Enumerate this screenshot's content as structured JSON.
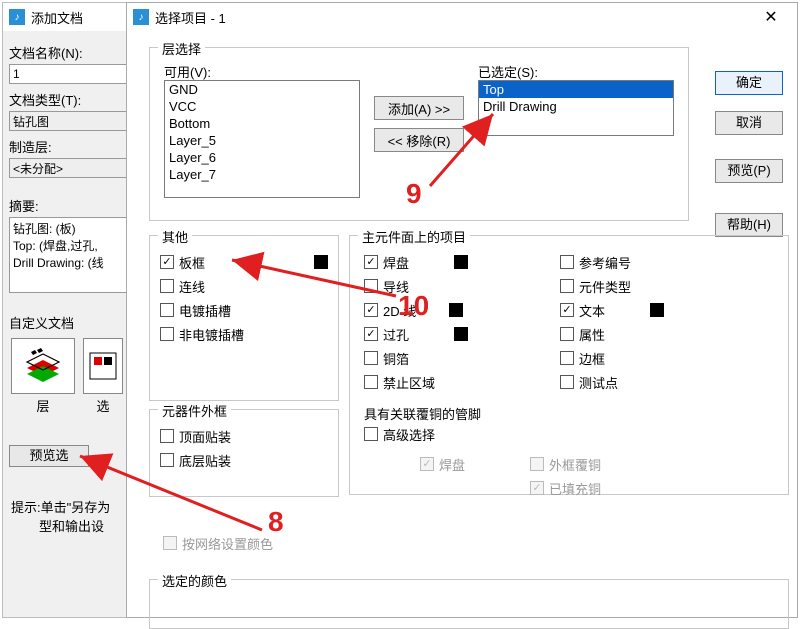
{
  "back": {
    "title": "添加文档",
    "docNameLabel": "文档名称(N):",
    "docNameValue": "1",
    "docTypeLabel": "文档类型(T):",
    "docTypeValue": "钻孔图",
    "mfgLayerLabel": "制造层:",
    "mfgLayerValue": "<未分配>",
    "summaryLabel": "摘要:",
    "summaryLines": [
      "钻孔图: (板)",
      "Top: (焊盘,过孔,",
      "Drill Drawing: (线"
    ],
    "customDocLabel": "自定义文档",
    "layerCaption": "层",
    "selCaption": "选",
    "previewBtn": "预览选",
    "hint1": "提示:单击\"另存为",
    "hint2": "型和输出设"
  },
  "front": {
    "title": "选择项目 - 1",
    "layerGroup": "层选择",
    "availLabel": "可用(V):",
    "availItems": [
      "GND",
      "VCC",
      "Bottom",
      "Layer_5",
      "Layer_6",
      "Layer_7"
    ],
    "addBtn": "添加(A) >>",
    "removeBtn": "<< 移除(R)",
    "selectedLabel": "已选定(S):",
    "selectedItems": [
      "Top",
      "Drill Drawing"
    ],
    "okBtn": "确定",
    "cancelBtn": "取消",
    "previewBtn": "预览(P)",
    "helpBtn": "帮助(H)",
    "otherGroup": "其他",
    "otherItems": [
      {
        "label": "板框",
        "checked": true,
        "swatch": true
      },
      {
        "label": "连线",
        "checked": false
      },
      {
        "label": "电镀插槽",
        "checked": false
      },
      {
        "label": "非电镀插槽",
        "checked": false
      }
    ],
    "outlineGroup": "元器件外框",
    "outlineItems": [
      {
        "label": "顶面贴装",
        "checked": false
      },
      {
        "label": "底层贴装",
        "checked": false
      }
    ],
    "mainGroup": "主元件面上的项目",
    "mainCol1": [
      {
        "label": "焊盘",
        "checked": true,
        "swatch": true
      },
      {
        "label": "导线",
        "checked": false
      },
      {
        "label": "2D 线",
        "checked": true,
        "swatch": true
      },
      {
        "label": "过孔",
        "checked": true,
        "swatch": true
      },
      {
        "label": "铜箔",
        "checked": false
      },
      {
        "label": "禁止区域",
        "checked": false
      }
    ],
    "mainCol2": [
      {
        "label": "参考编号",
        "checked": false
      },
      {
        "label": "元件类型",
        "checked": false
      },
      {
        "label": "文本",
        "checked": true,
        "swatch": true
      },
      {
        "label": "属性",
        "checked": false
      },
      {
        "label": "边框",
        "checked": false
      },
      {
        "label": "测试点",
        "checked": false
      }
    ],
    "pinGroup": "具有关联覆铜的管脚",
    "advSel": {
      "label": "高级选择",
      "checked": false
    },
    "disChecks": [
      {
        "label": "焊盘",
        "checked": true
      },
      {
        "label": "外框覆铜",
        "checked": false
      },
      {
        "label": "已填充铜",
        "checked": true
      }
    ],
    "byNet": {
      "label": "按网络设置颜色",
      "checked": false,
      "disabled": true
    },
    "colorGroup": "选定的颜色"
  },
  "anno": {
    "n8": "8",
    "n9": "9",
    "n10": "10"
  }
}
